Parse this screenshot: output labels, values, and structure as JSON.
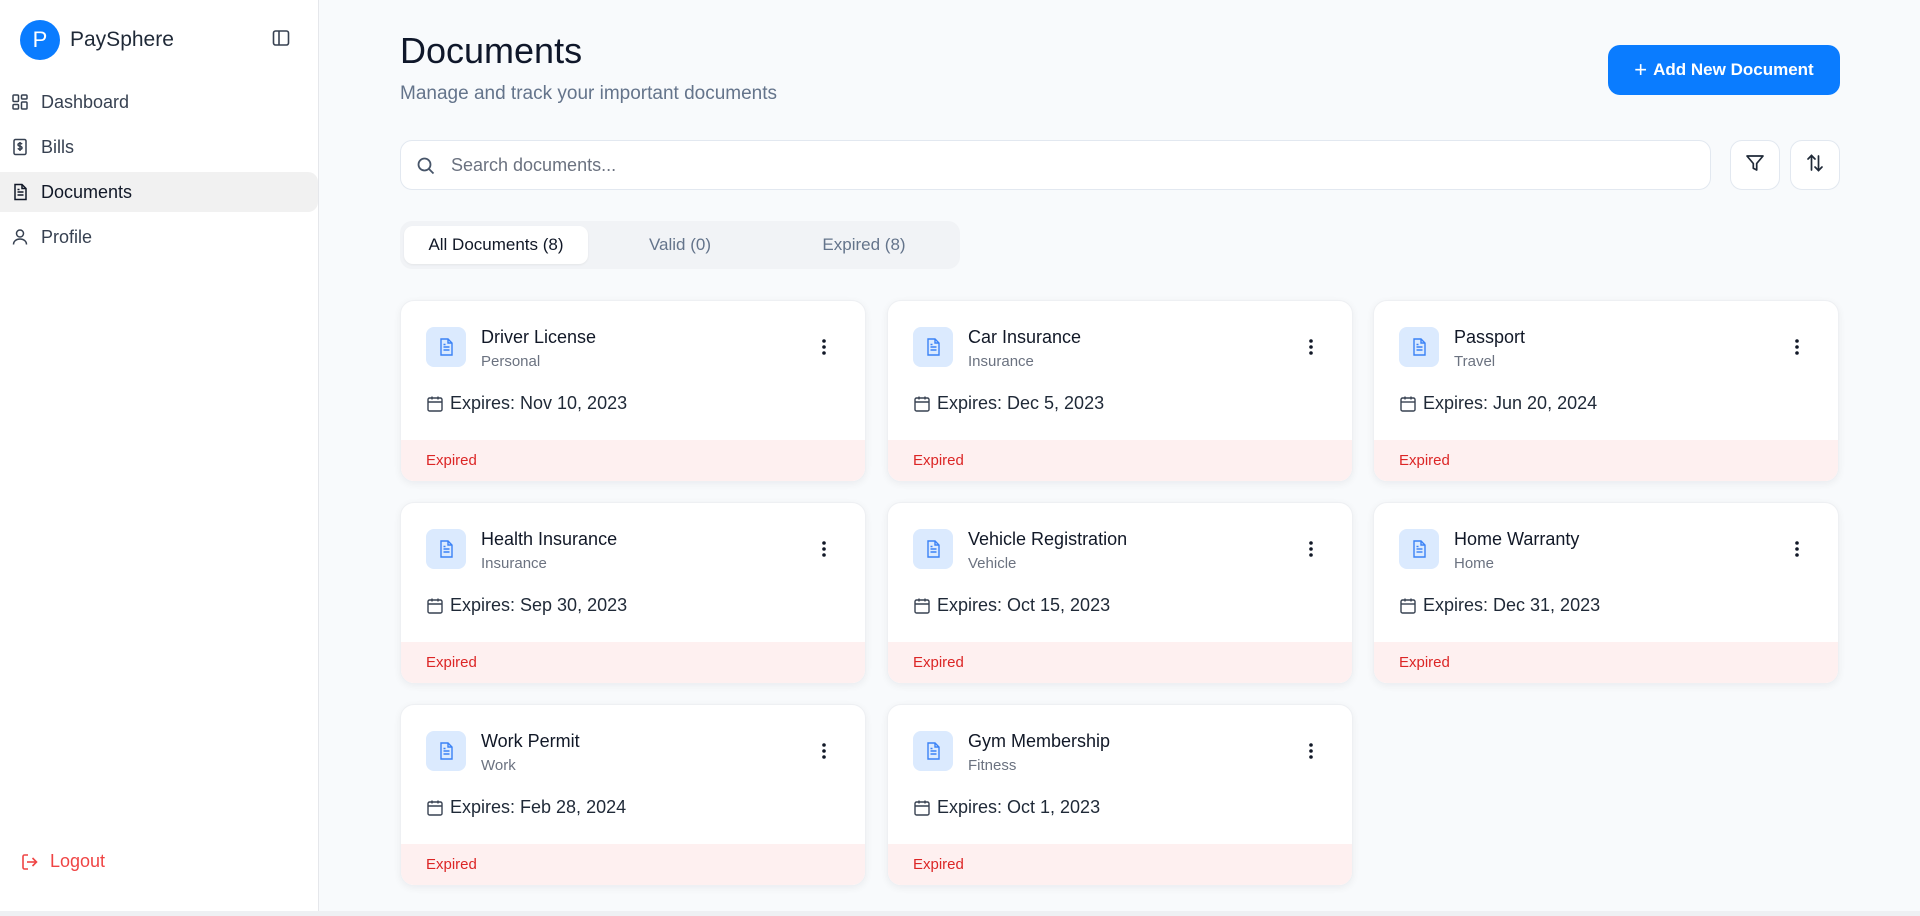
{
  "app": {
    "logo_letter": "P",
    "name": "PaySphere"
  },
  "sidebar": {
    "items": [
      {
        "label": "Dashboard",
        "icon": "grid-icon"
      },
      {
        "label": "Bills",
        "icon": "dollar-doc-icon"
      },
      {
        "label": "Documents",
        "icon": "document-icon",
        "active": true
      },
      {
        "label": "Profile",
        "icon": "user-icon"
      }
    ],
    "logout_label": "Logout"
  },
  "header": {
    "title": "Documents",
    "subtitle": "Manage and track your important documents",
    "add_button_label": "Add New Document"
  },
  "search": {
    "placeholder": "Search documents..."
  },
  "tabs": [
    {
      "label": "All Documents (8)",
      "active": true
    },
    {
      "label": "Valid (0)"
    },
    {
      "label": "Expired (8)"
    }
  ],
  "documents": [
    {
      "title": "Driver License",
      "category": "Personal",
      "expiry": "Expires: Nov 10, 2023",
      "status": "Expired"
    },
    {
      "title": "Car Insurance",
      "category": "Insurance",
      "expiry": "Expires: Dec 5, 2023",
      "status": "Expired"
    },
    {
      "title": "Passport",
      "category": "Travel",
      "expiry": "Expires: Jun 20, 2024",
      "status": "Expired"
    },
    {
      "title": "Health Insurance",
      "category": "Insurance",
      "expiry": "Expires: Sep 30, 2023",
      "status": "Expired"
    },
    {
      "title": "Vehicle Registration",
      "category": "Vehicle",
      "expiry": "Expires: Oct 15, 2023",
      "status": "Expired"
    },
    {
      "title": "Home Warranty",
      "category": "Home",
      "expiry": "Expires: Dec 31, 2023",
      "status": "Expired"
    },
    {
      "title": "Work Permit",
      "category": "Work",
      "expiry": "Expires: Feb 28, 2024",
      "status": "Expired"
    },
    {
      "title": "Gym Membership",
      "category": "Fitness",
      "expiry": "Expires: Oct 1, 2023",
      "status": "Expired"
    }
  ],
  "colors": {
    "accent": "#0a7cff",
    "expired_text": "#dc2626",
    "expired_bg": "#fef0f0",
    "logout": "#ef4444"
  }
}
